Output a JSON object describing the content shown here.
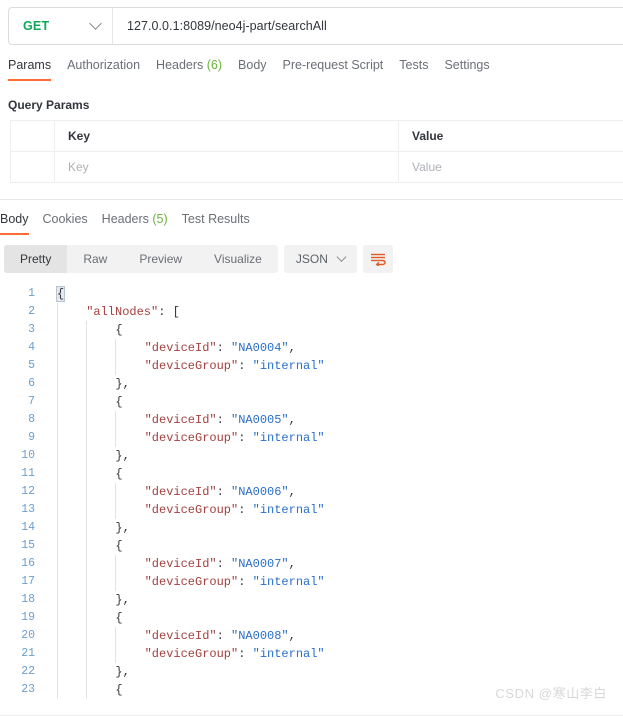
{
  "request_bar": {
    "method": "GET",
    "method_icon": "chevron-down-icon",
    "url": "127.0.0.1:8089/neo4j-part/searchAll"
  },
  "request_tabs": [
    {
      "label": "Params",
      "active": true
    },
    {
      "label": "Authorization",
      "active": false
    },
    {
      "label": "Headers",
      "count": "(6)",
      "active": false
    },
    {
      "label": "Body",
      "active": false
    },
    {
      "label": "Pre-request Script",
      "active": false
    },
    {
      "label": "Tests",
      "active": false
    },
    {
      "label": "Settings",
      "active": false
    }
  ],
  "query_params": {
    "title": "Query Params",
    "headers": {
      "key": "Key",
      "value": "Value"
    },
    "empty_row": {
      "key_placeholder": "Key",
      "value_placeholder": "Value"
    }
  },
  "response_tabs": [
    {
      "label": "Body",
      "active": true
    },
    {
      "label": "Cookies",
      "active": false
    },
    {
      "label": "Headers",
      "count": "(5)",
      "active": false
    },
    {
      "label": "Test Results",
      "active": false
    }
  ],
  "format_toolbar": {
    "views": [
      {
        "label": "Pretty",
        "active": true
      },
      {
        "label": "Raw",
        "active": false
      },
      {
        "label": "Preview",
        "active": false
      },
      {
        "label": "Visualize",
        "active": false
      }
    ],
    "language": "JSON",
    "language_icon": "chevron-down-icon",
    "wrap_icon": "word-wrap-icon"
  },
  "colors": {
    "accent": "#ff6c37",
    "method_get": "#0fa958",
    "count_green": "#6cb33f",
    "json_key": "#a53f3f",
    "json_string": "#2a6fc9",
    "line_number": "#6b9fd1"
  },
  "response_body": {
    "lines": [
      {
        "n": "1",
        "indent": 0,
        "tokens": [
          {
            "t": "{",
            "c": "brk hl"
          }
        ]
      },
      {
        "n": "2",
        "indent": 1,
        "tokens": [
          {
            "t": "\"allNodes\"",
            "c": "k"
          },
          {
            "t": ": ",
            "c": "p"
          },
          {
            "t": "[",
            "c": "brk"
          }
        ]
      },
      {
        "n": "3",
        "indent": 2,
        "tokens": [
          {
            "t": "{",
            "c": "brk"
          }
        ]
      },
      {
        "n": "4",
        "indent": 3,
        "tokens": [
          {
            "t": "\"deviceId\"",
            "c": "k"
          },
          {
            "t": ": ",
            "c": "p"
          },
          {
            "t": "\"NA0004\"",
            "c": "s"
          },
          {
            "t": ",",
            "c": "p"
          }
        ]
      },
      {
        "n": "5",
        "indent": 3,
        "tokens": [
          {
            "t": "\"deviceGroup\"",
            "c": "k"
          },
          {
            "t": ": ",
            "c": "p"
          },
          {
            "t": "\"internal\"",
            "c": "s"
          }
        ]
      },
      {
        "n": "6",
        "indent": 2,
        "tokens": [
          {
            "t": "}",
            "c": "brk"
          },
          {
            "t": ",",
            "c": "p"
          }
        ]
      },
      {
        "n": "7",
        "indent": 2,
        "tokens": [
          {
            "t": "{",
            "c": "brk"
          }
        ]
      },
      {
        "n": "8",
        "indent": 3,
        "tokens": [
          {
            "t": "\"deviceId\"",
            "c": "k"
          },
          {
            "t": ": ",
            "c": "p"
          },
          {
            "t": "\"NA0005\"",
            "c": "s"
          },
          {
            "t": ",",
            "c": "p"
          }
        ]
      },
      {
        "n": "9",
        "indent": 3,
        "tokens": [
          {
            "t": "\"deviceGroup\"",
            "c": "k"
          },
          {
            "t": ": ",
            "c": "p"
          },
          {
            "t": "\"internal\"",
            "c": "s"
          }
        ]
      },
      {
        "n": "10",
        "indent": 2,
        "tokens": [
          {
            "t": "}",
            "c": "brk"
          },
          {
            "t": ",",
            "c": "p"
          }
        ]
      },
      {
        "n": "11",
        "indent": 2,
        "tokens": [
          {
            "t": "{",
            "c": "brk"
          }
        ]
      },
      {
        "n": "12",
        "indent": 3,
        "tokens": [
          {
            "t": "\"deviceId\"",
            "c": "k"
          },
          {
            "t": ": ",
            "c": "p"
          },
          {
            "t": "\"NA0006\"",
            "c": "s"
          },
          {
            "t": ",",
            "c": "p"
          }
        ]
      },
      {
        "n": "13",
        "indent": 3,
        "tokens": [
          {
            "t": "\"deviceGroup\"",
            "c": "k"
          },
          {
            "t": ": ",
            "c": "p"
          },
          {
            "t": "\"internal\"",
            "c": "s"
          }
        ]
      },
      {
        "n": "14",
        "indent": 2,
        "tokens": [
          {
            "t": "}",
            "c": "brk"
          },
          {
            "t": ",",
            "c": "p"
          }
        ]
      },
      {
        "n": "15",
        "indent": 2,
        "tokens": [
          {
            "t": "{",
            "c": "brk"
          }
        ]
      },
      {
        "n": "16",
        "indent": 3,
        "tokens": [
          {
            "t": "\"deviceId\"",
            "c": "k"
          },
          {
            "t": ": ",
            "c": "p"
          },
          {
            "t": "\"NA0007\"",
            "c": "s"
          },
          {
            "t": ",",
            "c": "p"
          }
        ]
      },
      {
        "n": "17",
        "indent": 3,
        "tokens": [
          {
            "t": "\"deviceGroup\"",
            "c": "k"
          },
          {
            "t": ": ",
            "c": "p"
          },
          {
            "t": "\"internal\"",
            "c": "s"
          }
        ]
      },
      {
        "n": "18",
        "indent": 2,
        "tokens": [
          {
            "t": "}",
            "c": "brk"
          },
          {
            "t": ",",
            "c": "p"
          }
        ]
      },
      {
        "n": "19",
        "indent": 2,
        "tokens": [
          {
            "t": "{",
            "c": "brk"
          }
        ]
      },
      {
        "n": "20",
        "indent": 3,
        "tokens": [
          {
            "t": "\"deviceId\"",
            "c": "k"
          },
          {
            "t": ": ",
            "c": "p"
          },
          {
            "t": "\"NA0008\"",
            "c": "s"
          },
          {
            "t": ",",
            "c": "p"
          }
        ]
      },
      {
        "n": "21",
        "indent": 3,
        "tokens": [
          {
            "t": "\"deviceGroup\"",
            "c": "k"
          },
          {
            "t": ": ",
            "c": "p"
          },
          {
            "t": "\"internal\"",
            "c": "s"
          }
        ]
      },
      {
        "n": "22",
        "indent": 2,
        "tokens": [
          {
            "t": "}",
            "c": "brk"
          },
          {
            "t": ",",
            "c": "p"
          }
        ]
      },
      {
        "n": "23",
        "indent": 2,
        "tokens": [
          {
            "t": "{",
            "c": "brk"
          }
        ]
      }
    ]
  },
  "watermark": "CSDN @寒山李白"
}
